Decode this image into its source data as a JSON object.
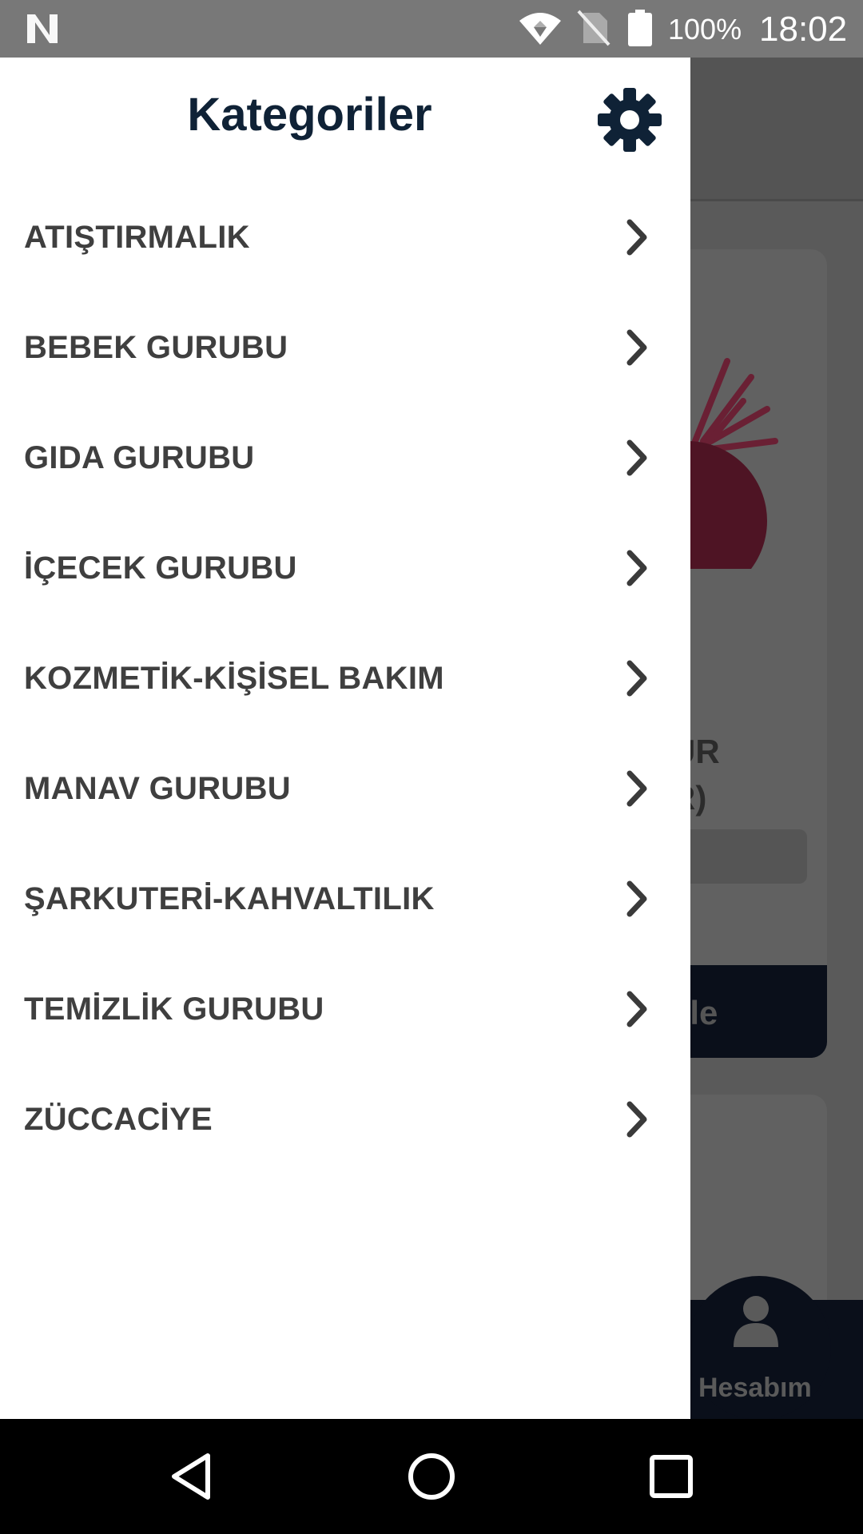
{
  "status_bar": {
    "battery_percent": "100%",
    "time": "18:02",
    "icons": [
      "n-logo-icon",
      "wifi-icon",
      "no-sim-icon",
      "battery-icon"
    ]
  },
  "drawer": {
    "title": "Kategoriler",
    "settings_icon": "gear-icon",
    "categories": [
      {
        "label": "ATIŞTIRMALIK"
      },
      {
        "label": "BEBEK GURUBU"
      },
      {
        "label": "GIDA GURUBU"
      },
      {
        "label": "İÇECEK GURUBU"
      },
      {
        "label": "KOZMETİK-KİŞİSEL BAKIM"
      },
      {
        "label": "MANAV GURUBU"
      },
      {
        "label": "ŞARKUTERİ-KAHVALTILIK"
      },
      {
        "label": "TEMİZLİK GURUBU"
      },
      {
        "label": "ZÜCCACİYE"
      }
    ],
    "chevron_icon": "chevron-right-icon"
  },
  "background": {
    "card_title_fragment": "UR\nR)",
    "add_button_fragment": "kle",
    "account_label": "Hesabım"
  },
  "nav_bar": {
    "icons": [
      "back-icon",
      "home-icon",
      "recents-icon"
    ]
  },
  "colors": {
    "title": "#0f2236",
    "item_text": "#3f3f3f",
    "status_bar": "#787878",
    "scrim": "#5a5a5a"
  }
}
